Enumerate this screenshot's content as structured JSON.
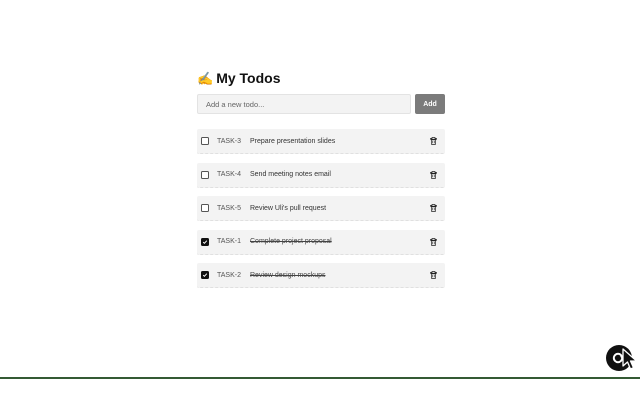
{
  "app": {
    "title_emoji": "✍️",
    "title": "My Todos"
  },
  "add": {
    "placeholder": "Add a new todo...",
    "button_label": "Add"
  },
  "todos": [
    {
      "id": "TASK-3",
      "text": "Prepare presentation slides",
      "completed": false
    },
    {
      "id": "TASK-4",
      "text": "Send meeting notes email",
      "completed": false
    },
    {
      "id": "TASK-5",
      "text": "Review Uli's pull request",
      "completed": false
    },
    {
      "id": "TASK-1",
      "text": "Complete project proposal",
      "completed": true
    },
    {
      "id": "TASK-2",
      "text": "Review design mockups",
      "completed": true
    }
  ],
  "icons": {
    "checkbox_checked": "check-icon",
    "delete": "trash-icon",
    "floating": "assistant-icon",
    "cursor": "cursor-pointer-icon"
  },
  "colors": {
    "add_button": "#7b7b7b",
    "item_background": "#f3f3f3",
    "bottom_line": "#345a34"
  }
}
